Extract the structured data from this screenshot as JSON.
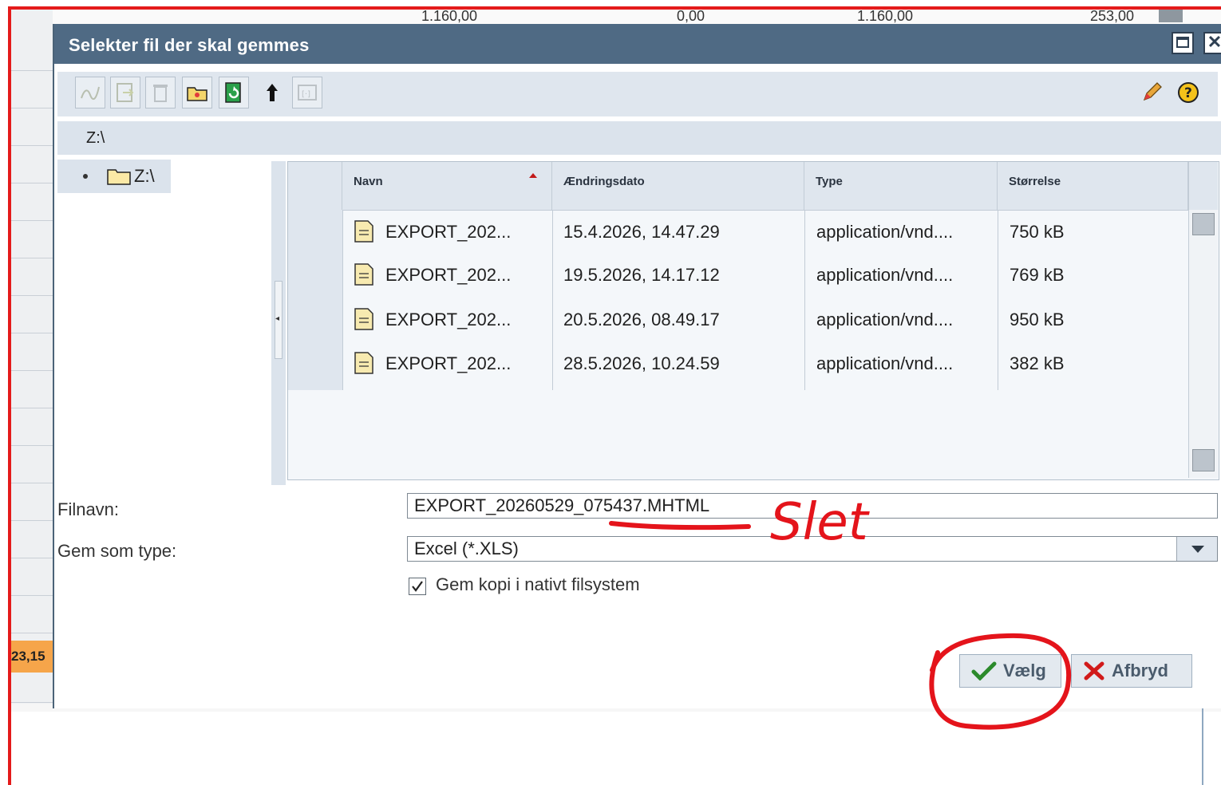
{
  "background_sheet": {
    "top_values": [
      "1.160,00",
      "0,00",
      "1.160,00",
      "253,00"
    ],
    "left_value": "23,15"
  },
  "dialog": {
    "title": "Selekter fil der skal gemmes",
    "path": "Z:\\",
    "tree": {
      "root_label": "Z:\\"
    },
    "table": {
      "columns": [
        "Navn",
        "Ændringsdato",
        "Type",
        "Størrelse"
      ],
      "rows": [
        {
          "name": "EXPORT_202...",
          "date": "15.4.2026, 14.47.29",
          "type": "application/vnd....",
          "size": "750 kB"
        },
        {
          "name": "EXPORT_202...",
          "date": "19.5.2026, 14.17.12",
          "type": "application/vnd....",
          "size": "769 kB"
        },
        {
          "name": "EXPORT_202...",
          "date": "20.5.2026, 08.49.17",
          "type": "application/vnd....",
          "size": "950 kB"
        },
        {
          "name": "EXPORT_202...",
          "date": "28.5.2026, 10.24.59",
          "type": "application/vnd....",
          "size": "382 kB"
        }
      ]
    },
    "filename": {
      "label": "Filnavn:",
      "value": "EXPORT_20260529_075437.MHTML"
    },
    "filetype": {
      "label": "Gem som type:",
      "value": "Excel (*.XLS)"
    },
    "copy_native": {
      "label": "Gem kopi i nativt filsystem",
      "checked": true
    },
    "buttons": {
      "choose": "Vælg",
      "cancel": "Afbryd"
    }
  },
  "annotation": {
    "text": "Slet",
    "color": "#e4141b"
  },
  "colors": {
    "titlebar": "#4f6a84",
    "frame": "#e41b1b"
  }
}
